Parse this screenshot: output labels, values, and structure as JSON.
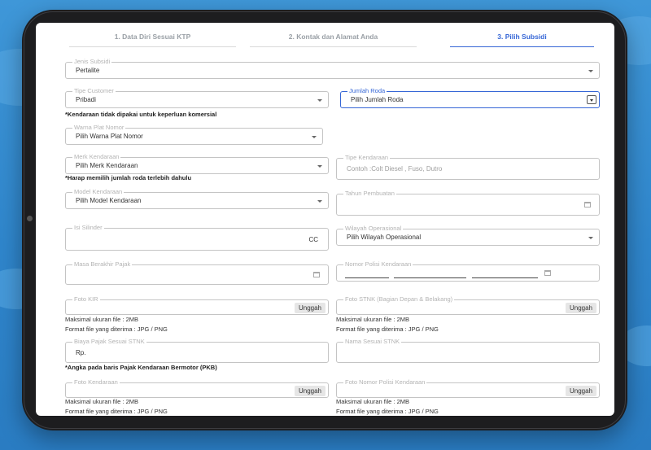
{
  "steps": [
    "1.  Data Diri Sesuai KTP",
    "2.  Kontak dan Alamat Anda",
    "3.  Pilih Subsidi"
  ],
  "active_step": 3,
  "colors": {
    "accent": "#3566d6",
    "background": "#3a8fd3",
    "device": "#1d1d1f"
  },
  "icons": {
    "dropdown": "chevron-down-icon",
    "calendar": "calendar-icon"
  },
  "form": {
    "jenis_subsidi": {
      "label": "Jenis Subsidi",
      "value": "Pertalite"
    },
    "tipe_customer": {
      "label": "Tipe Customer",
      "value": "Pribadi"
    },
    "jumlah_roda": {
      "label": "Jumlah Roda",
      "value": "Pilih Jumlah Roda"
    },
    "note_komersial": "*Kendaraan tidak dipakai untuk keperluan komersial",
    "warna_plat": {
      "label": "Warna Plat Nomor",
      "value": "Pilih Warna Plat Nomor"
    },
    "merk": {
      "label": "Merk Kendaraan",
      "value": "Pilih Merk Kendaraan"
    },
    "tipe_kendaraan": {
      "label": "Tipe Kendaraan",
      "placeholder": "Contoh :Colt Diesel , Fuso, Dutro"
    },
    "note_roda": "*Harap memilih jumlah roda terlebih dahulu",
    "model": {
      "label": "Model Kendaraan",
      "value": "Pilih Model Kendaraan"
    },
    "tahun": {
      "label": "Tahun Pembuatan"
    },
    "isi_silinder": {
      "label": "Isi Silinder",
      "suffix": "CC"
    },
    "wilayah": {
      "label": "Wilayah Operasional",
      "value": "Pilih Wilayah Operasional"
    },
    "masa_pajak": {
      "label": "Masa Berakhir Pajak"
    },
    "nomor_polisi": {
      "label": "Nomor Polisi Kendaraan"
    },
    "foto_kir": {
      "label": "Foto KIR",
      "button": "Unggah"
    },
    "foto_stnk": {
      "label": "Foto STNK (Bagian Depan & Belakang)",
      "button": "Unggah"
    },
    "max_size": "Maksimal ukuran file : 2MB",
    "format": "Format file yang diterima : JPG / PNG",
    "biaya_pajak": {
      "label": "Biaya Pajak Sesuai STNK",
      "prefix": "Rp."
    },
    "nama_stnk": {
      "label": "Nama Sesuai STNK"
    },
    "note_pkb": "*Angka pada baris Pajak Kendaraan Bermotor (PKB)",
    "foto_kendaraan": {
      "label": "Foto Kendaraan",
      "button": "Unggah"
    },
    "foto_nopol": {
      "label": "Foto Nomor Polisi Kendaraan",
      "button": "Unggah"
    }
  }
}
